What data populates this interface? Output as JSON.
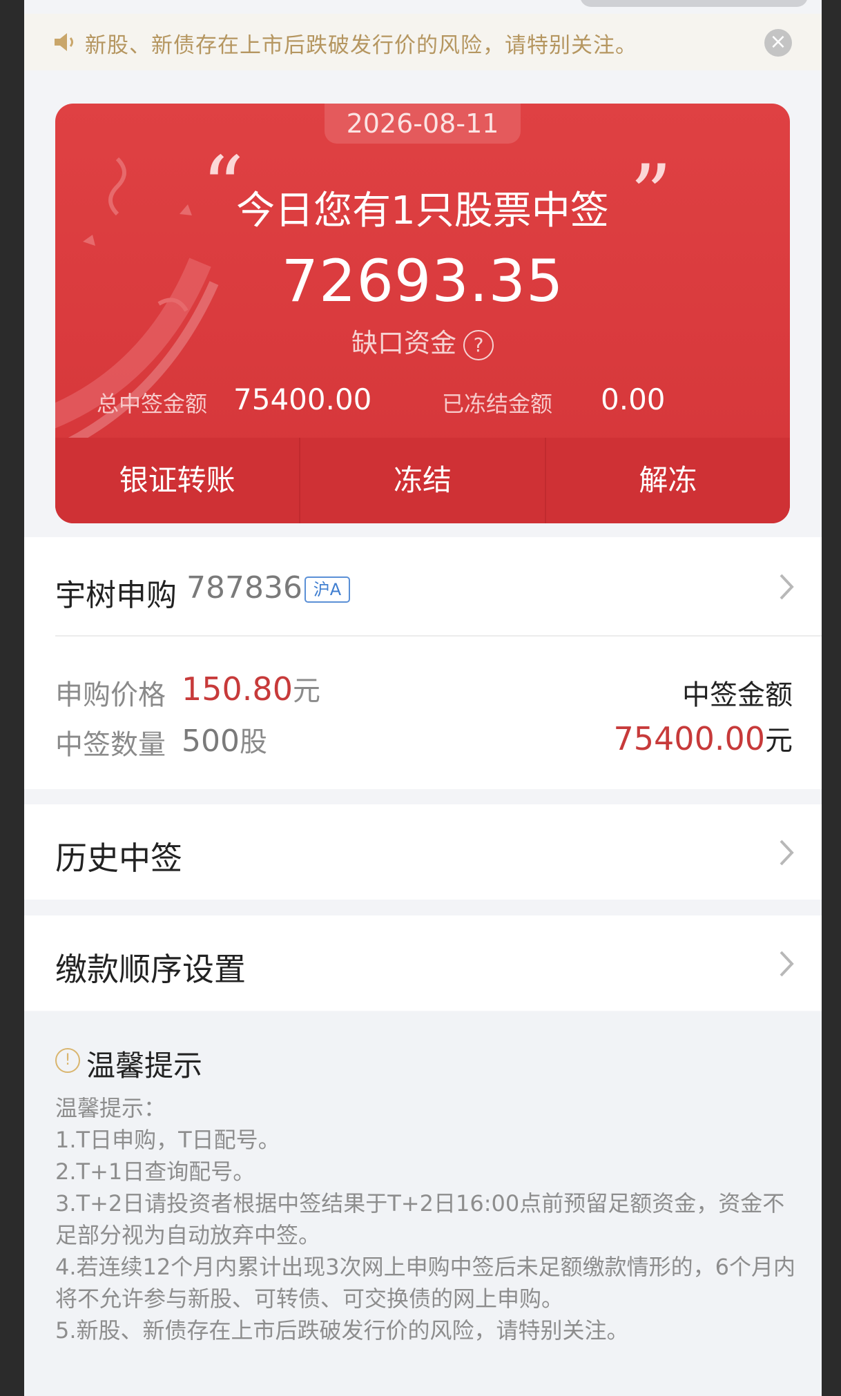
{
  "notice": {
    "text": "新股、新债存在上市后跌破发行价的风险，请特别关注。",
    "close_symbol": "×"
  },
  "card": {
    "date": "2026-08-11",
    "quote_open": "“",
    "quote_close": "”",
    "headline": "今日您有1只股票中签",
    "amount": "72693.35",
    "amount_label": "缺口资金",
    "help_symbol": "?",
    "total_label": "总中签金额",
    "total_value": "75400.00",
    "frozen_label": "已冻结金额",
    "frozen_value": "0.00",
    "actions": [
      "银证转账",
      "冻结",
      "解冻"
    ]
  },
  "stock": {
    "name": "宇树申购",
    "code": "787836",
    "market_tag": "沪A",
    "price_label": "申购价格",
    "price_value": "150.80",
    "price_unit": "元",
    "qty_label": "中签数量",
    "qty_value": "500",
    "qty_unit": "股",
    "win_amount_label": "中签金额",
    "win_amount_value": "75400.00",
    "win_amount_unit": "元"
  },
  "history": {
    "title": "历史中签"
  },
  "payment_order": {
    "title": "缴款顺序设置"
  },
  "tips": {
    "icon_symbol": "!",
    "title": "温馨提示",
    "lines": [
      "温馨提示：",
      "1.T日申购，T日配号。",
      "2.T+1日查询配号。",
      "3.T+2日请投资者根据中签结果于T+2日16:00点前预留足额资金，资金不足部分视为自动放弃中签。",
      "4.若连续12个月内累计出现3次网上申购中签后未足额缴款情形的，6个月内将不允许参与新股、可转债、可交换债的网上申购。",
      "5.新股、新债存在上市后跌破发行价的风险，请特别关注。"
    ]
  },
  "colors": {
    "card_red": "#df4143",
    "accent_red": "#c73a3a",
    "notice_gold": "#b59660",
    "tag_blue": "#3f7ed0"
  }
}
